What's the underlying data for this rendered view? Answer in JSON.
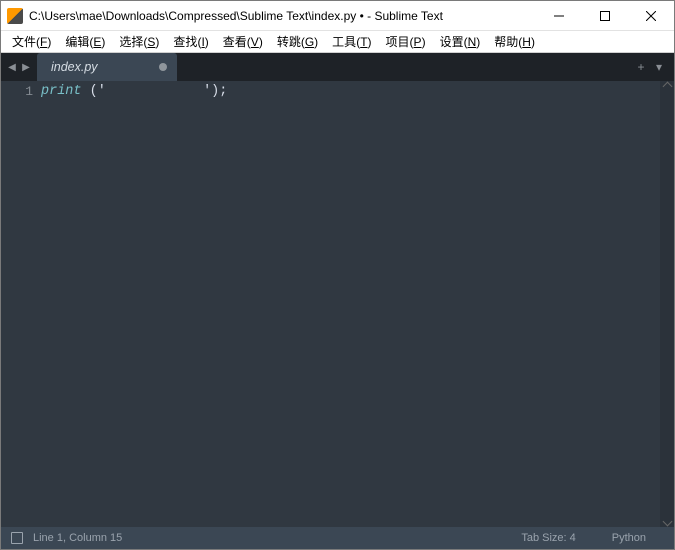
{
  "window": {
    "title": "C:\\Users\\mae\\Downloads\\Compressed\\Sublime Text\\index.py • - Sublime Text"
  },
  "menu": {
    "file": {
      "label": "文件",
      "accel": "F"
    },
    "edit": {
      "label": "编辑",
      "accel": "E"
    },
    "select": {
      "label": "选择",
      "accel": "S"
    },
    "find": {
      "label": "查找",
      "accel": "I"
    },
    "view": {
      "label": "查看",
      "accel": "V"
    },
    "goto": {
      "label": "转跳",
      "accel": "G"
    },
    "tools": {
      "label": "工具",
      "accel": "T"
    },
    "project": {
      "label": "项目",
      "accel": "P"
    },
    "settings": {
      "label": "设置",
      "accel": "N"
    },
    "help": {
      "label": "帮助",
      "accel": "H"
    }
  },
  "tabs": {
    "active": {
      "label": "index.py",
      "dirty": true
    }
  },
  "editor": {
    "gutter": {
      "line1": "1"
    },
    "line1": {
      "func": "print",
      "space": " ",
      "open": "(",
      "quote1": "'",
      "padding": "            ",
      "quote2": "'",
      "close": ")",
      "semi": ";"
    }
  },
  "status": {
    "position": "Line 1, Column 15",
    "tabsize": "Tab Size: 4",
    "syntax": "Python"
  }
}
